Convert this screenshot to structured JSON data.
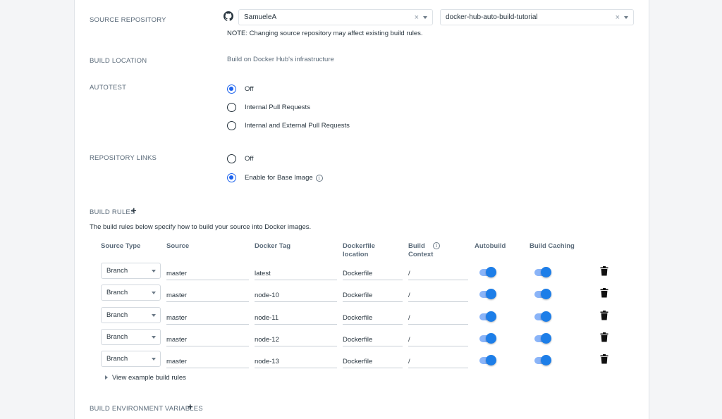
{
  "source_repository": {
    "label": "SOURCE REPOSITORY",
    "org": "SamueleA",
    "repo": "docker-hub-auto-build-tutorial",
    "clear_glyph": "×",
    "note": "NOTE: Changing source repository may affect existing build rules."
  },
  "build_location": {
    "label": "BUILD LOCATION",
    "value": "Build on Docker Hub's infrastructure"
  },
  "autotest": {
    "label": "AUTOTEST",
    "options": [
      {
        "label": "Off",
        "selected": true
      },
      {
        "label": "Internal Pull Requests",
        "selected": false
      },
      {
        "label": "Internal and External Pull Requests",
        "selected": false
      }
    ]
  },
  "repository_links": {
    "label": "REPOSITORY LINKS",
    "options": [
      {
        "label": "Off",
        "selected": false
      },
      {
        "label": "Enable for Base Image",
        "selected": true
      }
    ],
    "info_glyph": "i"
  },
  "build_rules": {
    "label": "BUILD RULES",
    "add_glyph": "+",
    "description": "The build rules below specify how to build your source into Docker images.",
    "columns": {
      "source_type": "Source Type",
      "source": "Source",
      "docker_tag": "Docker Tag",
      "dockerfile_1": "Dockerfile",
      "dockerfile_2": "location",
      "context_1": "Build",
      "context_2": "Context",
      "autobuild": "Autobuild",
      "build_caching": "Build Caching"
    },
    "info_glyph": "i",
    "rows": [
      {
        "source_type": "Branch",
        "source": "master",
        "docker_tag": "latest",
        "dockerfile": "Dockerfile",
        "context": "/",
        "autobuild": true,
        "build_caching": true
      },
      {
        "source_type": "Branch",
        "source": "master",
        "docker_tag": "node-10",
        "dockerfile": "Dockerfile",
        "context": "/",
        "autobuild": true,
        "build_caching": true
      },
      {
        "source_type": "Branch",
        "source": "master",
        "docker_tag": "node-11",
        "dockerfile": "Dockerfile",
        "context": "/",
        "autobuild": true,
        "build_caching": true
      },
      {
        "source_type": "Branch",
        "source": "master",
        "docker_tag": "node-12",
        "dockerfile": "Dockerfile",
        "context": "/",
        "autobuild": true,
        "build_caching": true
      },
      {
        "source_type": "Branch",
        "source": "master",
        "docker_tag": "node-13",
        "dockerfile": "Dockerfile",
        "context": "/",
        "autobuild": true,
        "build_caching": true
      }
    ],
    "view_examples": "View example build rules"
  },
  "build_env_vars": {
    "label": "BUILD ENVIRONMENT VARIABLES",
    "add_glyph": "+"
  },
  "colors": {
    "accent": "#1d63ed",
    "toggle_track": "#8ab4f8",
    "toggle_knob": "#1d7ee8",
    "text": "#27343e",
    "muted": "#5b6b7a"
  }
}
